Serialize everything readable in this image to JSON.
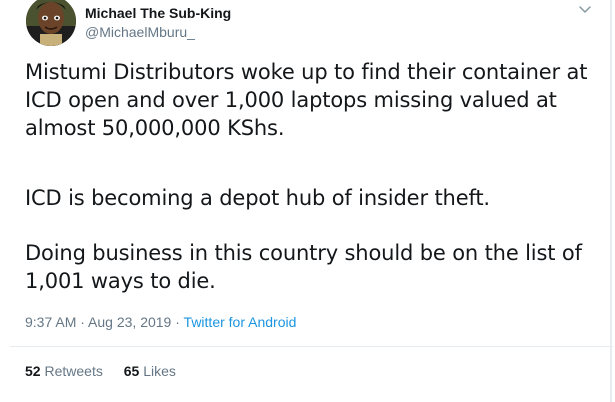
{
  "author": {
    "display_name": "Michael The Sub-King",
    "handle": "@MichaelMburu_"
  },
  "tweet": {
    "paragraph_1": "Mistumi Distributors woke up to find their container at\nICD open and over 1,000 laptops missing valued at\nalmost 50,000,000 KShs.",
    "paragraph_2": "ICD is becoming a depot hub of insider theft.",
    "paragraph_3": "Doing business in this country should be on the list of\n1,001 ways to die."
  },
  "meta": {
    "time": "9:37 AM",
    "separator_1": " · ",
    "date": "Aug 23, 2019",
    "separator_2": " · ",
    "source": "Twitter for Android"
  },
  "stats": {
    "retweets_count": "52",
    "retweets_label": "Retweets",
    "likes_count": "65",
    "likes_label": "Likes"
  },
  "icons": {
    "menu": "chevron-down-icon"
  },
  "colors": {
    "text": "#14171a",
    "secondary": "#657786",
    "link": "#1b95e0",
    "divider": "#e6ecf0"
  }
}
